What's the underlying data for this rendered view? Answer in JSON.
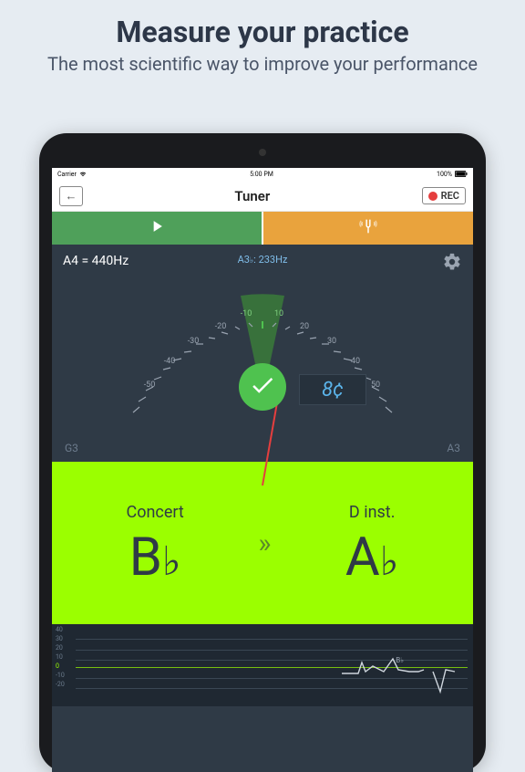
{
  "promo": {
    "headline": "Measure your practice",
    "subline": "The most scientific way to improve your performance"
  },
  "status": {
    "carrier": "Carrier",
    "time": "5:00 PM",
    "battery": "100%"
  },
  "nav": {
    "title": "Tuner",
    "rec": "REC"
  },
  "tuner": {
    "reference": "A4 = 440Hz",
    "detected_note": "A3",
    "detected_flat": "♭",
    "detected_suffix": ": 233Hz",
    "cents": "8¢",
    "range_low": "G3",
    "range_high": "A3",
    "ticks": {
      "n50": "-50",
      "n40": "-40",
      "n30": "-30",
      "n20": "-20",
      "n10": "-10",
      "p10": "10",
      "p20": "20",
      "p30": "30",
      "p40": "40",
      "p50": "50"
    }
  },
  "transpose": {
    "left_label": "Concert",
    "left_note": "B",
    "left_accidental": "♭",
    "right_label": "D inst.",
    "right_note": "A",
    "right_accidental": "♭",
    "arrow": "»"
  },
  "graph": {
    "l40": "40",
    "l30": "30",
    "l20": "20",
    "l10": "10",
    "l0": "0",
    "ln10": "-10",
    "ln20": "-20",
    "note": "B♭"
  }
}
